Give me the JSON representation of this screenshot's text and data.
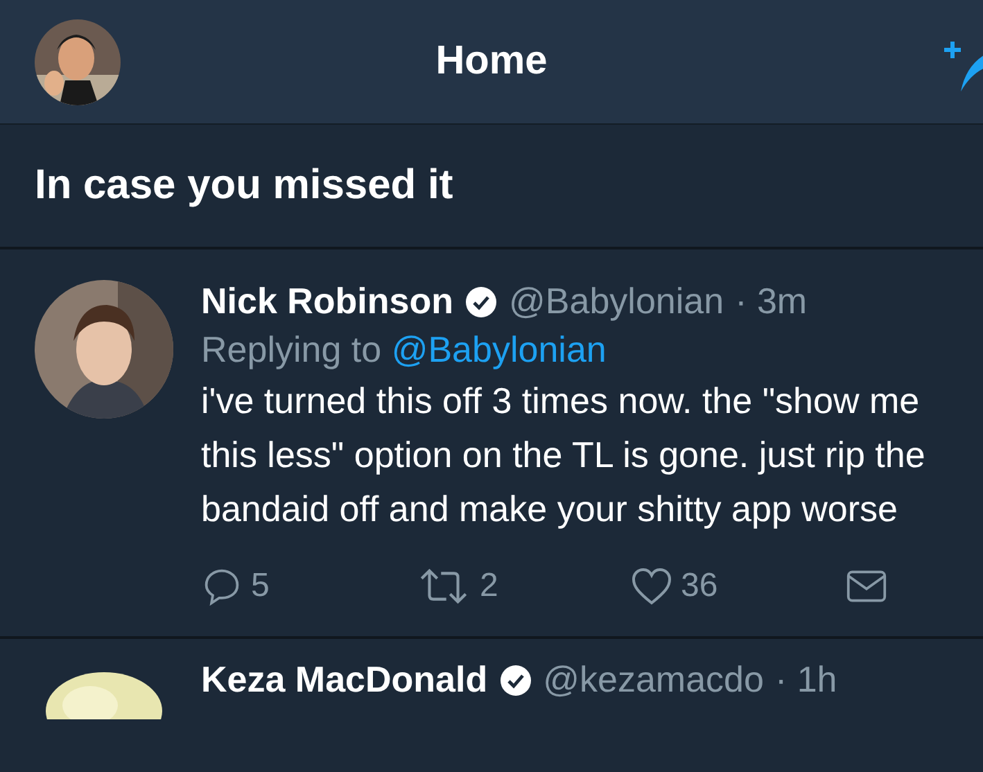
{
  "header": {
    "title": "Home"
  },
  "section": {
    "title": "In case you missed it"
  },
  "tweets": [
    {
      "name": "Nick Robinson",
      "verified": true,
      "handle": "@Babylonian",
      "time": "· 3m",
      "reply_prefix": "Replying to",
      "reply_to": "@Babylonian",
      "text": "i've turned this off 3 times now. the \"show me this less\" option on the TL is gone. just rip the bandaid off and make your shitty app worse",
      "actions": [
        {
          "kind": "reply",
          "count": "5"
        },
        {
          "kind": "retweet",
          "count": "2"
        },
        {
          "kind": "like",
          "count": "36"
        },
        {
          "kind": "message"
        }
      ]
    },
    {
      "name": "Keza MacDonald",
      "verified": true,
      "handle": "@kezamacdo",
      "time": "· 1h"
    }
  ]
}
